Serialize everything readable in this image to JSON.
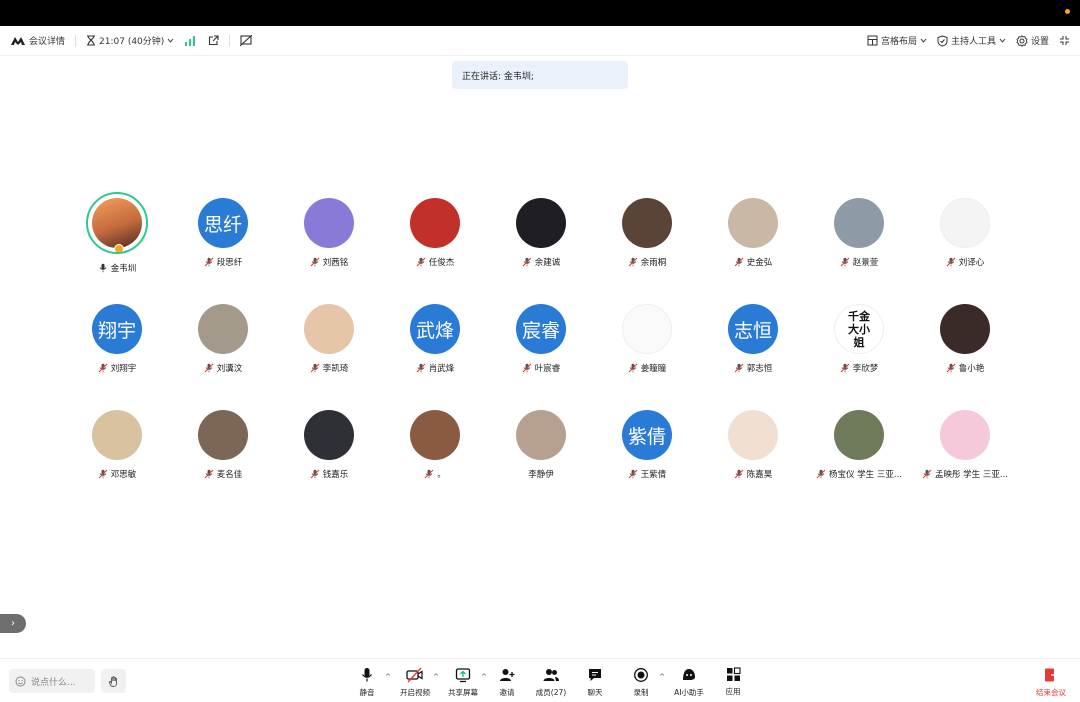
{
  "toolbar": {
    "meeting_details": "会议详情",
    "time": "21:07 (40分钟)",
    "grid_layout": "宫格布局",
    "host_tools": "主持人工具",
    "settings": "设置"
  },
  "speaking": "正在讲话: 金韦圳;",
  "participants": [
    {
      "name": "金韦圳",
      "mic": "on",
      "avatar_color": "#c46a3e",
      "avatar_text": "",
      "ring": true
    },
    {
      "name": "段思纤",
      "mic": "muted",
      "avatar_color": "#2a7bd5",
      "avatar_text": "思纤"
    },
    {
      "name": "刘茜铭",
      "mic": "muted",
      "avatar_color": "#8a7ad8",
      "avatar_text": ""
    },
    {
      "name": "任俊杰",
      "mic": "muted",
      "avatar_color": "#c2302a",
      "avatar_text": ""
    },
    {
      "name": "余建诚",
      "mic": "muted",
      "avatar_color": "#1e1e24",
      "avatar_text": ""
    },
    {
      "name": "余雨桐",
      "mic": "muted",
      "avatar_color": "#5a4438",
      "avatar_text": ""
    },
    {
      "name": "史金弘",
      "mic": "muted",
      "avatar_color": "#c9b8a6",
      "avatar_text": ""
    },
    {
      "name": "赵景萱",
      "mic": "muted",
      "avatar_color": "#8e9aa6",
      "avatar_text": ""
    },
    {
      "name": "刘译心",
      "mic": "muted",
      "avatar_color": "#f4f4f4",
      "avatar_text": ""
    },
    {
      "name": "刘翔宇",
      "mic": "muted",
      "avatar_color": "#2a7bd5",
      "avatar_text": "翔宇"
    },
    {
      "name": "刘瀵汶",
      "mic": "muted",
      "avatar_color": "#a49a8c",
      "avatar_text": ""
    },
    {
      "name": "李凯琦",
      "mic": "muted",
      "avatar_color": "#e6c6a8",
      "avatar_text": ""
    },
    {
      "name": "肖武烽",
      "mic": "muted",
      "avatar_color": "#2a7bd5",
      "avatar_text": "武烽"
    },
    {
      "name": "叶宸睿",
      "mic": "muted",
      "avatar_color": "#2a7bd5",
      "avatar_text": "宸睿"
    },
    {
      "name": "姜瞳瞳",
      "mic": "muted",
      "avatar_color": "#fafafa",
      "avatar_text": ""
    },
    {
      "name": "郭志恒",
      "mic": "muted",
      "avatar_color": "#2a7bd5",
      "avatar_text": "志恒"
    },
    {
      "name": "李欣梦",
      "mic": "muted",
      "avatar_color": "#ffffff",
      "avatar_text": "千金大小姐"
    },
    {
      "name": "鲁小艳",
      "mic": "muted",
      "avatar_color": "#3a2a28",
      "avatar_text": ""
    },
    {
      "name": "邓思敏",
      "mic": "muted",
      "avatar_color": "#d8c2a0",
      "avatar_text": ""
    },
    {
      "name": "麦名佳",
      "mic": "muted",
      "avatar_color": "#7c6656",
      "avatar_text": ""
    },
    {
      "name": "钱嘉乐",
      "mic": "muted",
      "avatar_color": "#2e3036",
      "avatar_text": ""
    },
    {
      "name": "。",
      "mic": "muted",
      "avatar_color": "#8a5a42",
      "avatar_text": ""
    },
    {
      "name": "李静伊",
      "mic": "none",
      "avatar_color": "#b8a090",
      "avatar_text": ""
    },
    {
      "name": "王紫倩",
      "mic": "muted",
      "avatar_color": "#2a7bd5",
      "avatar_text": "紫倩"
    },
    {
      "name": "陈嘉昊",
      "mic": "muted",
      "avatar_color": "#f1e0d2",
      "avatar_text": ""
    },
    {
      "name": "杨宝仪 学生 三亚...",
      "mic": "muted",
      "avatar_color": "#6e7a5a",
      "avatar_text": ""
    },
    {
      "name": "孟映彤 学生 三亚...",
      "mic": "muted",
      "avatar_color": "#f6c8dc",
      "avatar_text": ""
    }
  ],
  "bottom": {
    "say_placeholder": "说点什么...",
    "mute": "静音",
    "video": "开启视频",
    "share": "共享屏幕",
    "invite": "邀请",
    "members": "成员(27)",
    "chat": "聊天",
    "record": "录制",
    "ai": "AI小助手",
    "apps": "应用",
    "end": "结束会议"
  }
}
